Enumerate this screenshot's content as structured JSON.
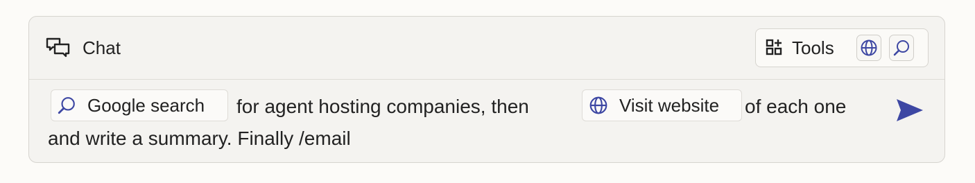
{
  "header": {
    "title": "Chat",
    "tools_label": "Tools"
  },
  "composer": {
    "chip_google": "Google search",
    "text_1": "for agent hosting companies, then",
    "chip_visit": "Visit website",
    "text_2": "of each one",
    "text_3": "and write a summary. Finally /email"
  },
  "icons": {
    "chat": "chat-bubbles-icon",
    "tools": "tools-grid-icon",
    "globe": "globe-icon",
    "search": "search-icon",
    "send": "send-icon"
  },
  "colors": {
    "accent": "#3d47a3",
    "panel_bg": "#f4f3f0",
    "border": "#d6d4cf"
  }
}
